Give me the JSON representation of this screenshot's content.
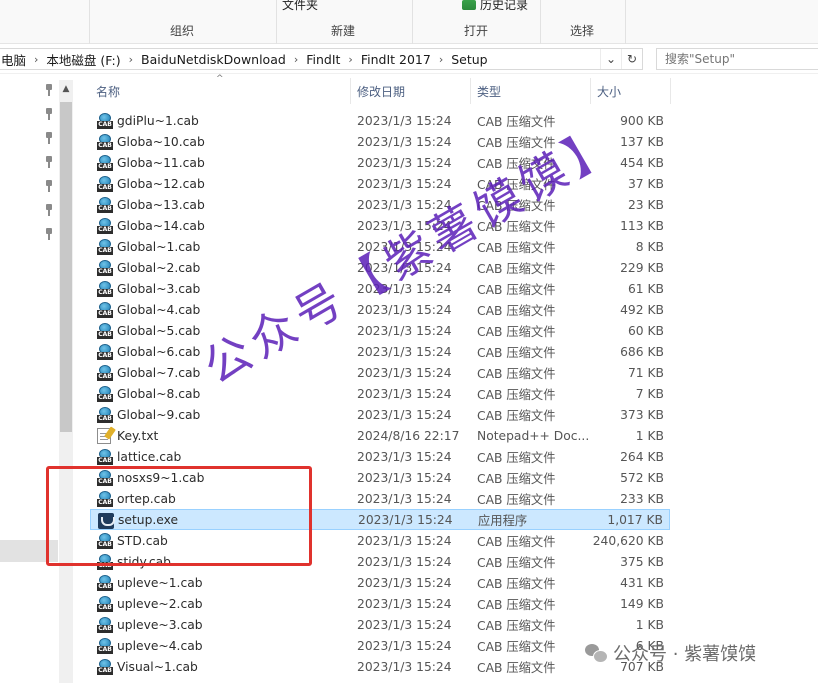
{
  "ribbon": {
    "partial_new_folder": "文件夹",
    "partial_history": "历史记录",
    "groups": [
      "组织",
      "新建",
      "打开",
      "选择"
    ]
  },
  "address": {
    "crumbs": [
      "电脑",
      "本地磁盘 (F:)",
      "BaiduNetdiskDownload",
      "FindIt",
      "FindIt 2017",
      "Setup"
    ],
    "dropdown_icon": "chevron-down-icon",
    "refresh_icon": "refresh-icon"
  },
  "search": {
    "placeholder": "搜索\"Setup\""
  },
  "columns": {
    "name": "名称",
    "date": "修改日期",
    "type": "类型",
    "size": "大小"
  },
  "files": [
    {
      "name": "gdiPlu~1.cab",
      "date": "2023/1/3 15:24",
      "type": "CAB 压缩文件",
      "size": "900 KB",
      "icon": "cab"
    },
    {
      "name": "Globa~10.cab",
      "date": "2023/1/3 15:24",
      "type": "CAB 压缩文件",
      "size": "137 KB",
      "icon": "cab"
    },
    {
      "name": "Globa~11.cab",
      "date": "2023/1/3 15:24",
      "type": "CAB 压缩文件",
      "size": "454 KB",
      "icon": "cab"
    },
    {
      "name": "Globa~12.cab",
      "date": "2023/1/3 15:24",
      "type": "CAB 压缩文件",
      "size": "37 KB",
      "icon": "cab"
    },
    {
      "name": "Globa~13.cab",
      "date": "2023/1/3 15:24",
      "type": "CAB 压缩文件",
      "size": "23 KB",
      "icon": "cab"
    },
    {
      "name": "Globa~14.cab",
      "date": "2023/1/3 15:24",
      "type": "CAB 压缩文件",
      "size": "113 KB",
      "icon": "cab"
    },
    {
      "name": "Global~1.cab",
      "date": "2023/1/3 15:24",
      "type": "CAB 压缩文件",
      "size": "8 KB",
      "icon": "cab"
    },
    {
      "name": "Global~2.cab",
      "date": "2023/1/3 15:24",
      "type": "CAB 压缩文件",
      "size": "229 KB",
      "icon": "cab"
    },
    {
      "name": "Global~3.cab",
      "date": "2023/1/3 15:24",
      "type": "CAB 压缩文件",
      "size": "61 KB",
      "icon": "cab"
    },
    {
      "name": "Global~4.cab",
      "date": "2023/1/3 15:24",
      "type": "CAB 压缩文件",
      "size": "492 KB",
      "icon": "cab"
    },
    {
      "name": "Global~5.cab",
      "date": "2023/1/3 15:24",
      "type": "CAB 压缩文件",
      "size": "60 KB",
      "icon": "cab"
    },
    {
      "name": "Global~6.cab",
      "date": "2023/1/3 15:24",
      "type": "CAB 压缩文件",
      "size": "686 KB",
      "icon": "cab"
    },
    {
      "name": "Global~7.cab",
      "date": "2023/1/3 15:24",
      "type": "CAB 压缩文件",
      "size": "71 KB",
      "icon": "cab"
    },
    {
      "name": "Global~8.cab",
      "date": "2023/1/3 15:24",
      "type": "CAB 压缩文件",
      "size": "7 KB",
      "icon": "cab"
    },
    {
      "name": "Global~9.cab",
      "date": "2023/1/3 15:24",
      "type": "CAB 压缩文件",
      "size": "373 KB",
      "icon": "cab"
    },
    {
      "name": "Key.txt",
      "date": "2024/8/16 22:17",
      "type": "Notepad++ Doc...",
      "size": "1 KB",
      "icon": "txt"
    },
    {
      "name": "lattice.cab",
      "date": "2023/1/3 15:24",
      "type": "CAB 压缩文件",
      "size": "264 KB",
      "icon": "cab"
    },
    {
      "name": "nosxs9~1.cab",
      "date": "2023/1/3 15:24",
      "type": "CAB 压缩文件",
      "size": "572 KB",
      "icon": "cab"
    },
    {
      "name": "ortep.cab",
      "date": "2023/1/3 15:24",
      "type": "CAB 压缩文件",
      "size": "233 KB",
      "icon": "cab"
    },
    {
      "name": "setup.exe",
      "date": "2023/1/3 15:24",
      "type": "应用程序",
      "size": "1,017 KB",
      "icon": "exe",
      "selected": true
    },
    {
      "name": "STD.cab",
      "date": "2023/1/3 15:24",
      "type": "CAB 压缩文件",
      "size": "240,620 KB",
      "icon": "cab"
    },
    {
      "name": "stidy.cab",
      "date": "2023/1/3 15:24",
      "type": "CAB 压缩文件",
      "size": "375 KB",
      "icon": "cab"
    },
    {
      "name": "upleve~1.cab",
      "date": "2023/1/3 15:24",
      "type": "CAB 压缩文件",
      "size": "431 KB",
      "icon": "cab"
    },
    {
      "name": "upleve~2.cab",
      "date": "2023/1/3 15:24",
      "type": "CAB 压缩文件",
      "size": "149 KB",
      "icon": "cab"
    },
    {
      "name": "upleve~3.cab",
      "date": "2023/1/3 15:24",
      "type": "CAB 压缩文件",
      "size": "1 KB",
      "icon": "cab"
    },
    {
      "name": "upleve~4.cab",
      "date": "2023/1/3 15:24",
      "type": "CAB 压缩文件",
      "size": "6 KB",
      "icon": "cab"
    },
    {
      "name": "Visual~1.cab",
      "date": "2023/1/3 15:24",
      "type": "CAB 压缩文件",
      "size": "707 KB",
      "icon": "cab"
    }
  ],
  "watermark": {
    "diagonal": "公众号【紫薯馍馍】",
    "bottom": "公众号 · 紫薯馍馍"
  },
  "colors": {
    "selection": "#cce8ff",
    "highlight_box": "#e0322d",
    "watermark": "#5b1fb8"
  }
}
